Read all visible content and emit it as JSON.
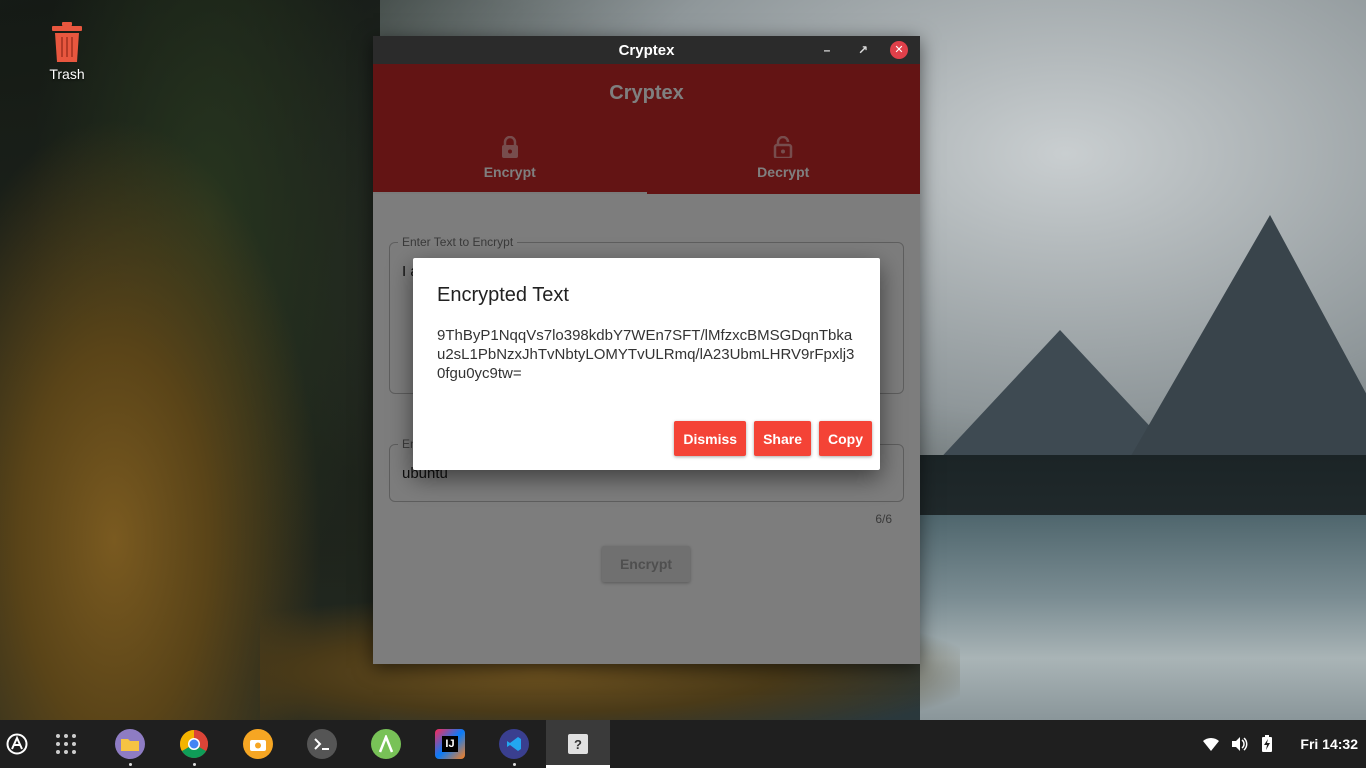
{
  "desktop": {
    "trash_label": "Trash"
  },
  "window": {
    "title": "Cryptex"
  },
  "app": {
    "title": "Cryptex",
    "tabs": [
      {
        "label": "Encrypt",
        "icon": "lock-icon",
        "active": true
      },
      {
        "label": "Decrypt",
        "icon": "unlock-icon",
        "active": false
      }
    ],
    "text_field": {
      "legend": "Enter Text to Encrypt",
      "value": "I a"
    },
    "key_field": {
      "legend": "En",
      "value": "ubuntu",
      "counter": "6/6"
    },
    "encrypt_button": "Encrypt"
  },
  "dialog": {
    "title": "Encrypted Text",
    "body": "9ThByP1NqqVs7lo398kdbY7WEn7SFT/lMfzxcBMSGDqnTbkau2sL1PbNzxJhTvNbtyLOMYTvULRmq/lA23UbmLHRV9rFpxlj30fgu0yc9tw=",
    "buttons": {
      "dismiss": "Dismiss",
      "share": "Share",
      "copy": "Copy"
    }
  },
  "taskbar": {
    "apps": [
      "activities-icon",
      "app-grid-icon",
      "files-icon",
      "chrome-icon",
      "screenshot-icon",
      "terminal-icon",
      "android-studio-icon",
      "intellij-icon",
      "vscode-icon",
      "cryptex-icon"
    ],
    "intellij_badge": "IJ",
    "cryptex_badge": "?",
    "clock": "Fri 14:32"
  },
  "colors": {
    "appbar": "#c62828",
    "dialog_button": "#f44336",
    "taskbar": "#1f1f1f"
  }
}
